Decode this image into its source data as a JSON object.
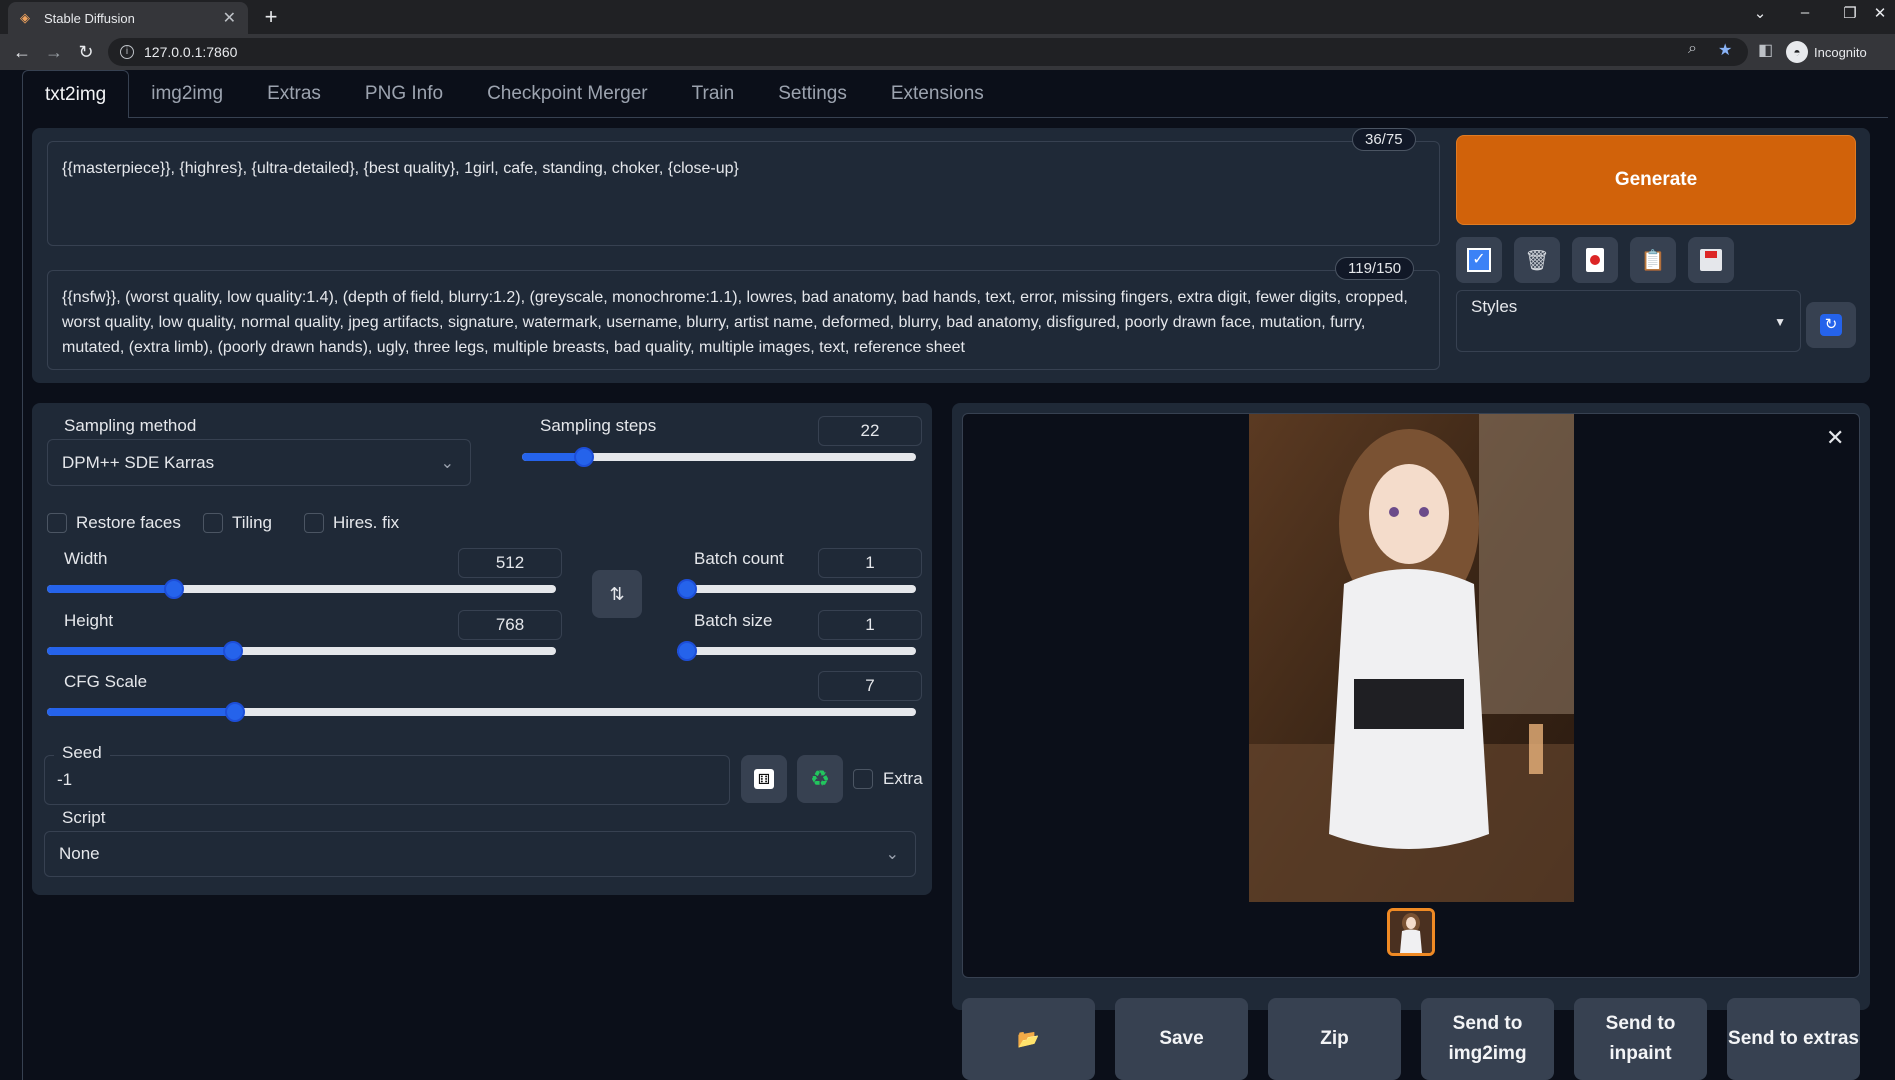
{
  "browser": {
    "tab_title": "Stable Diffusion",
    "new_tab": "+",
    "url": "127.0.0.1:7860",
    "profile": "Incognito"
  },
  "app_tabs": [
    "txt2img",
    "img2img",
    "Extras",
    "PNG Info",
    "Checkpoint Merger",
    "Train",
    "Settings",
    "Extensions"
  ],
  "prompt": {
    "text": "{{masterpiece}}, {highres}, {ultra-detailed}, {best quality}, 1girl, cafe, standing, choker, {close-up}",
    "counter": "36/75"
  },
  "negative_prompt": {
    "text": "{{nsfw}}, (worst quality, low quality:1.4), (depth of field, blurry:1.2), (greyscale, monochrome:1.1), lowres, bad anatomy, bad hands, text, error, missing fingers, extra digit, fewer digits, cropped, worst quality, low quality, normal quality, jpeg artifacts, signature, watermark, username, blurry, artist name, deformed, blurry, bad anatomy, disfigured, poorly drawn face, mutation, furry, mutated, (extra limb), (poorly drawn hands), ugly, three legs, multiple breasts, bad quality, multiple images, text, reference sheet",
    "counter": "119/150"
  },
  "generate_label": "Generate",
  "styles_label": "Styles",
  "sampling": {
    "method_label": "Sampling method",
    "method_value": "DPM++ SDE Karras",
    "steps_label": "Sampling steps",
    "steps_value": "22",
    "steps_fraction": 0.14
  },
  "checkboxes": {
    "restore_faces": "Restore faces",
    "tiling": "Tiling",
    "hires_fix": "Hires. fix",
    "extra": "Extra"
  },
  "width": {
    "label": "Width",
    "value": "512",
    "fraction": 0.24
  },
  "height": {
    "label": "Height",
    "value": "768",
    "fraction": 0.36
  },
  "batch_count": {
    "label": "Batch count",
    "value": "1",
    "fraction": 0.0
  },
  "batch_size": {
    "label": "Batch size",
    "value": "1",
    "fraction": 0.0
  },
  "cfg": {
    "label": "CFG Scale",
    "value": "7",
    "fraction": 0.21
  },
  "seed": {
    "label": "Seed",
    "value": "-1"
  },
  "script": {
    "label": "Script",
    "value": "None"
  },
  "output_buttons": {
    "save": "Save",
    "zip": "Zip",
    "send_img2img": "Send to img2img",
    "send_inpaint": "Send to inpaint",
    "send_extras": "Send to extras"
  }
}
